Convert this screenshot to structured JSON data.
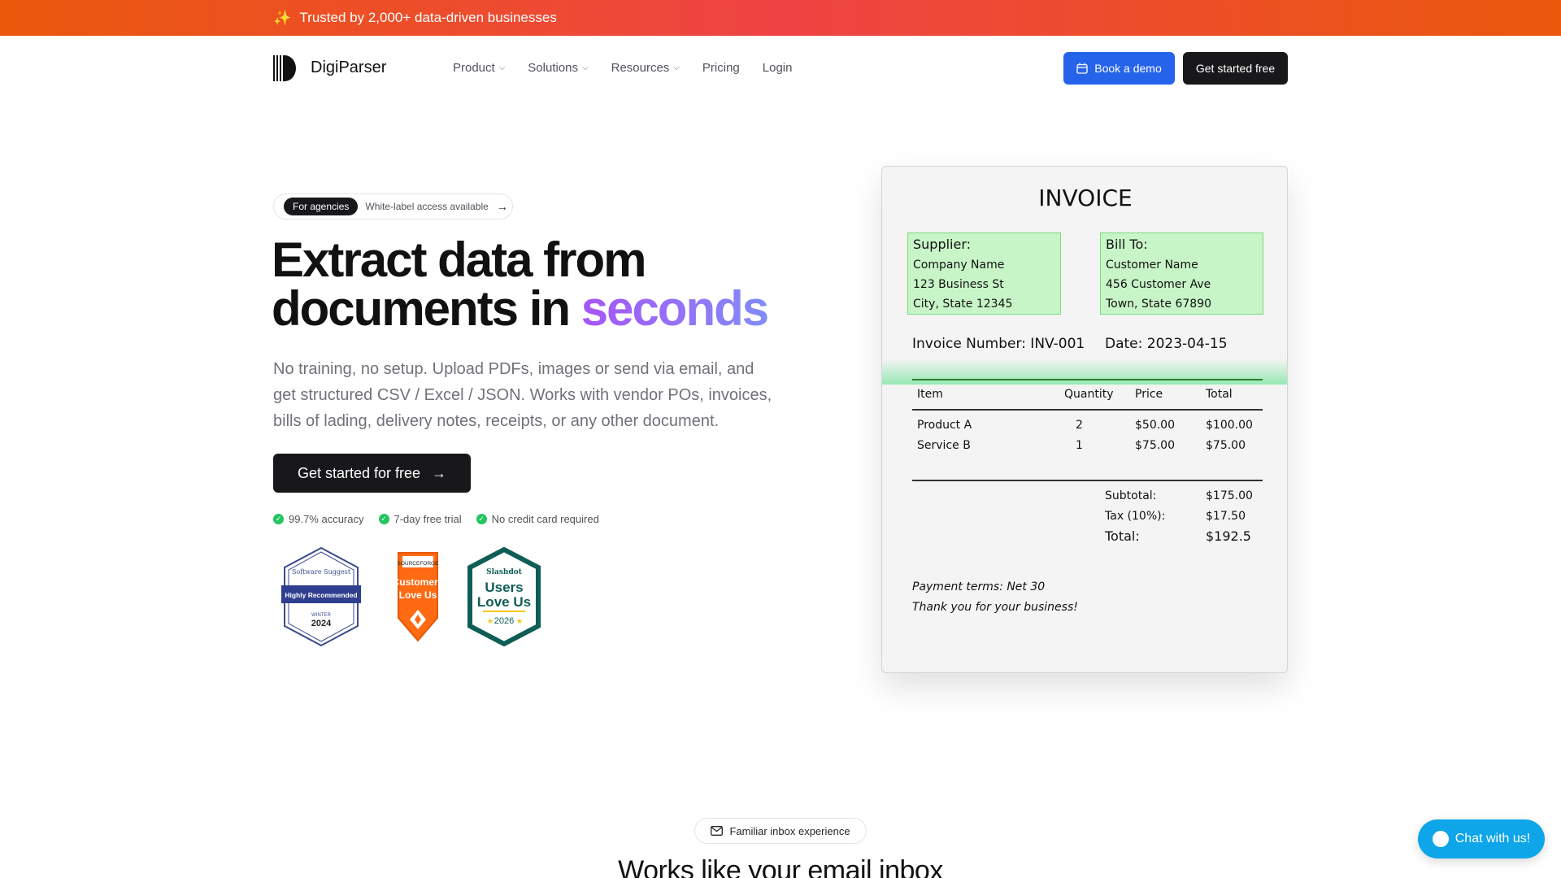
{
  "banner": {
    "text": "Trusted by 2,000+ data-driven businesses",
    "icon": "sparkles-icon"
  },
  "nav": {
    "brand": "DigiParser",
    "menu": [
      {
        "label": "Product",
        "dropdown": true
      },
      {
        "label": "Solutions",
        "dropdown": true
      },
      {
        "label": "Resources",
        "dropdown": true
      },
      {
        "label": "Pricing",
        "dropdown": false
      },
      {
        "label": "Login",
        "dropdown": false
      }
    ],
    "demo_label": "Book a demo",
    "start_label": "Get started free"
  },
  "hero": {
    "pill_tag": "For agencies",
    "pill_text": "White-label access available",
    "headline_line1": "Extract data from",
    "headline_line2_prefix": "documents in ",
    "headline_accent": "seconds",
    "subtext": "No training, no setup. Upload PDFs, images or send via email, and get structured CSV / Excel / JSON. Works with vendor POs, invoices, bills of lading, delivery notes, receipts, or any other document.",
    "cta_label": "Get started for free",
    "checks": [
      "99.7% accuracy",
      "7-day free trial",
      "No credit card required"
    ],
    "badges": {
      "software_suggest": {
        "brand": "Software Suggest",
        "ribbon": "Highly Recommended",
        "season": "WINTER",
        "year": "2024"
      },
      "sourceforge": {
        "brand": "SOURCEFORGE",
        "line1": "Customers",
        "line2": "Love Us"
      },
      "slashdot": {
        "brand": "Slashdot",
        "line1": "Users",
        "line2": "Love Us",
        "year": "2026"
      }
    }
  },
  "invoice": {
    "title": "INVOICE",
    "supplier": {
      "heading": "Supplier:",
      "lines": [
        "Company Name",
        "123 Business St",
        "City, State 12345"
      ]
    },
    "bill_to": {
      "heading": "Bill To:",
      "lines": [
        "Customer Name",
        "456 Customer Ave",
        "Town, State 67890"
      ]
    },
    "invoice_number": "Invoice Number: INV-001",
    "date": "Date: 2023-04-15",
    "columns": [
      "Item",
      "Quantity",
      "Price",
      "Total"
    ],
    "rows": [
      {
        "item": "Product A",
        "qty": "2",
        "price": "$50.00",
        "total": "$100.00"
      },
      {
        "item": "Service B",
        "qty": "1",
        "price": "$75.00",
        "total": "$75.00"
      }
    ],
    "subtotal_label": "Subtotal:",
    "subtotal": "$175.00",
    "tax_label": "Tax (10%):",
    "tax": "$17.50",
    "total_label": "Total:",
    "total": "$192.5",
    "terms": "Payment terms: Net 30",
    "thanks": "Thank you for your business!"
  },
  "section": {
    "pill": "Familiar inbox experience",
    "title": "Works like your email inbox"
  },
  "chat": {
    "label": "Chat with us!"
  },
  "colors": {
    "brand_blue": "#2563eb",
    "dark": "#18181b",
    "accent_purple": "#a855f7",
    "highlight_green": "#c8f5c8",
    "chat_blue": "#0ea5e9"
  }
}
